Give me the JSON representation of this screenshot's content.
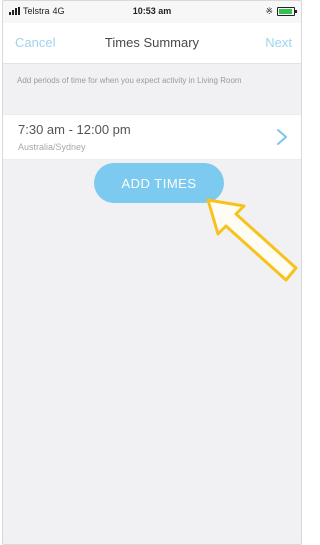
{
  "status_bar": {
    "carrier": "Telstra",
    "network": "4G",
    "time": "10:53 am"
  },
  "nav": {
    "cancel_label": "Cancel",
    "title": "Times Summary",
    "next_label": "Next"
  },
  "instruction_text": "Add periods of time for when you expect activity in Living Room",
  "time_entries": [
    {
      "range": "7:30 am - 12:00 pm",
      "timezone": "Australia/Sydney"
    }
  ],
  "add_button_label": "ADD TIMES",
  "colors": {
    "accent": "#7dcaf0",
    "nav_link": "#9fd4ee",
    "annotation_arrow": "#f6c31c",
    "background": "#f1f1f4"
  }
}
